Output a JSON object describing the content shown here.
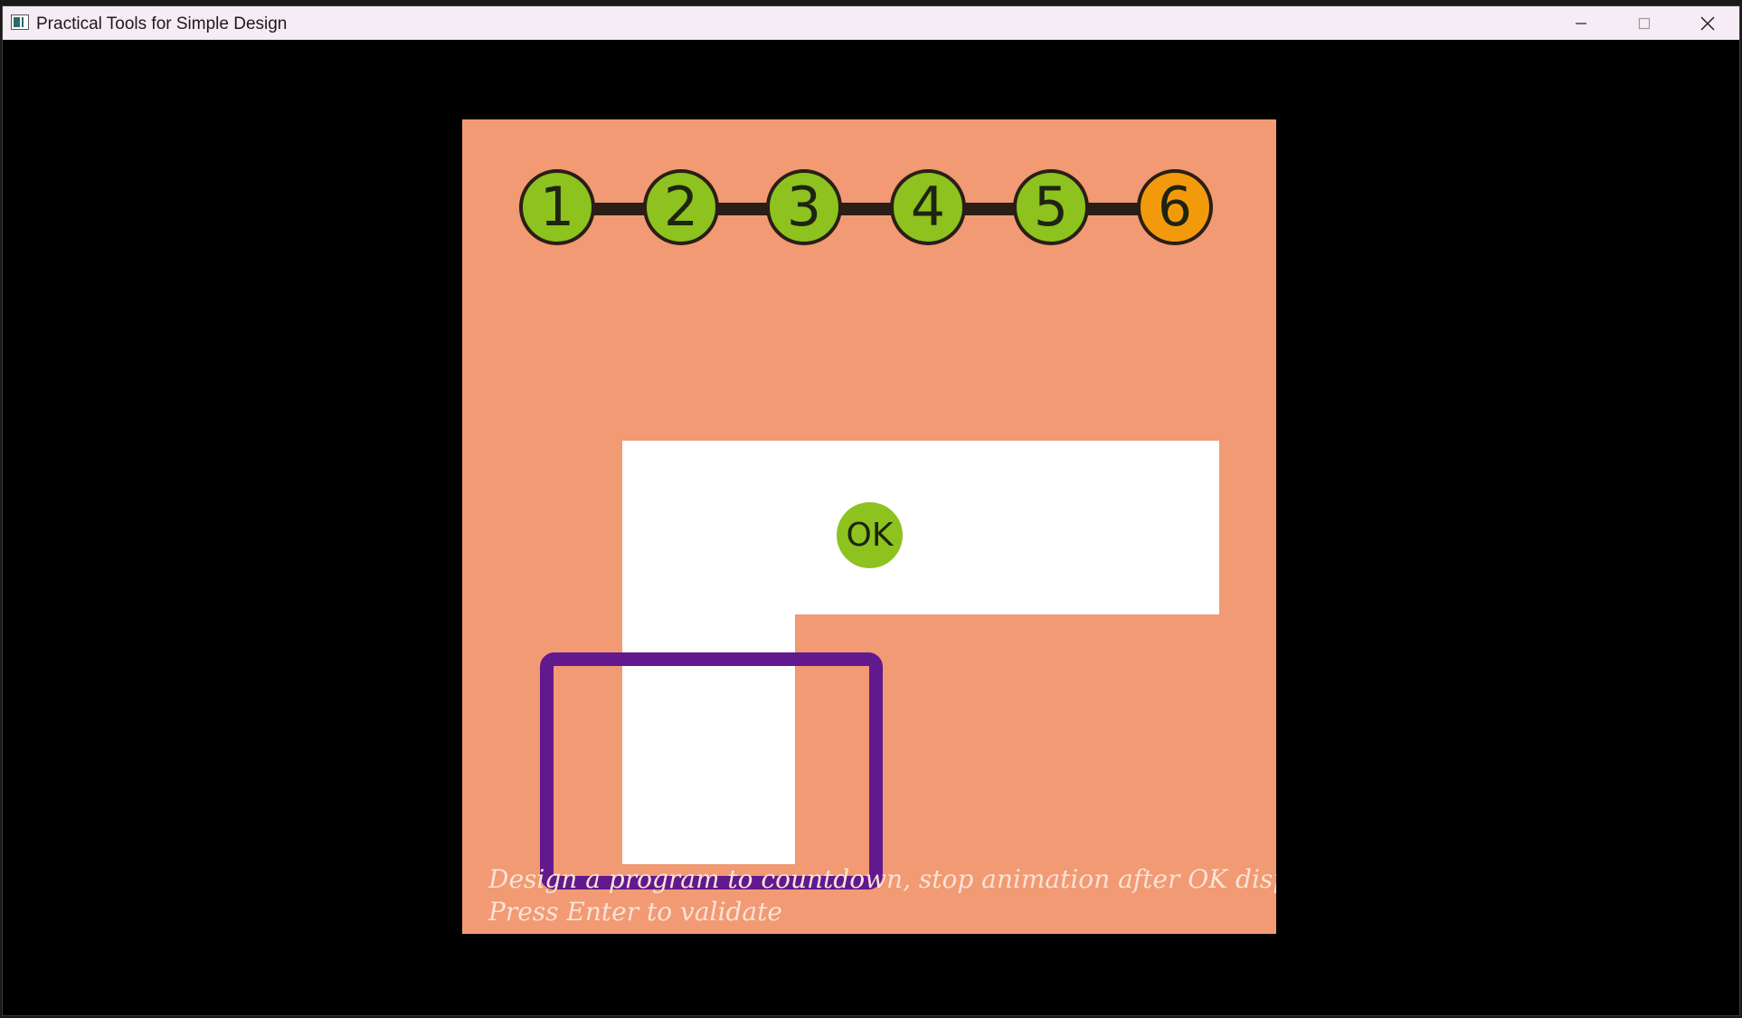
{
  "window": {
    "title": "Practical Tools for Simple Design",
    "controls": {
      "minimize": "minimize-icon",
      "maximize": "maximize-icon",
      "close": "close-icon"
    }
  },
  "game": {
    "steps": [
      {
        "label": "1",
        "status": "done"
      },
      {
        "label": "2",
        "status": "done"
      },
      {
        "label": "3",
        "status": "done"
      },
      {
        "label": "4",
        "status": "done"
      },
      {
        "label": "5",
        "status": "done"
      },
      {
        "label": "6",
        "status": "current"
      }
    ],
    "ok_label": "OK",
    "instruction_line1": "Design a program to countdown, stop animation after OK display",
    "instruction_line2": "Press Enter to validate"
  },
  "colors": {
    "background": "#f19a73",
    "step_done": "#8dc21f",
    "step_current": "#f39a0c",
    "step_line": "#2a1e16",
    "path": "#ffffff",
    "cursor": "#62198e",
    "instruction_text": "#fbe3d6"
  }
}
